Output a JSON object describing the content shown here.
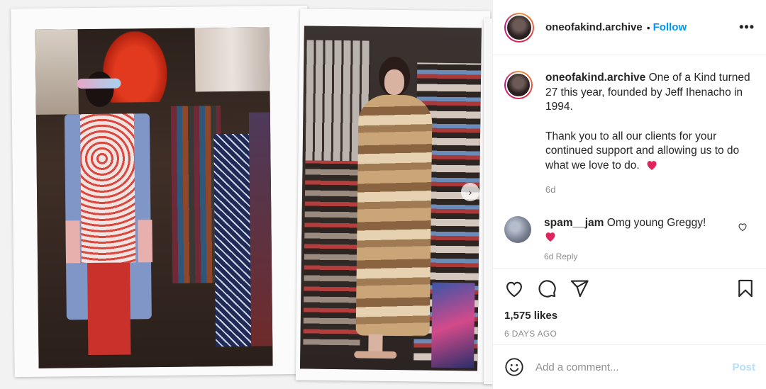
{
  "post": {
    "username": "oneofakind.archive",
    "follow_label": "Follow",
    "more_label": "•••",
    "caption_p1": "One of a Kind turned 27 this year, founded by Jeff Ihenacho in 1994.",
    "caption_p2": "Thank you to all our clients for your continued support and allowing us to do what we love to do.",
    "caption_time": "6d",
    "likes": "1,575 likes",
    "date": "6 DAYS AGO"
  },
  "comments": [
    {
      "username": "spam__jam",
      "text": "Omg young Greggy!",
      "meta": "6d  Reply"
    }
  ],
  "composer": {
    "placeholder": "Add a comment...",
    "post_label": "Post"
  },
  "colors": {
    "link": "#0095f6",
    "post_disabled": "#b2dffc",
    "heart": "#e0245e"
  }
}
